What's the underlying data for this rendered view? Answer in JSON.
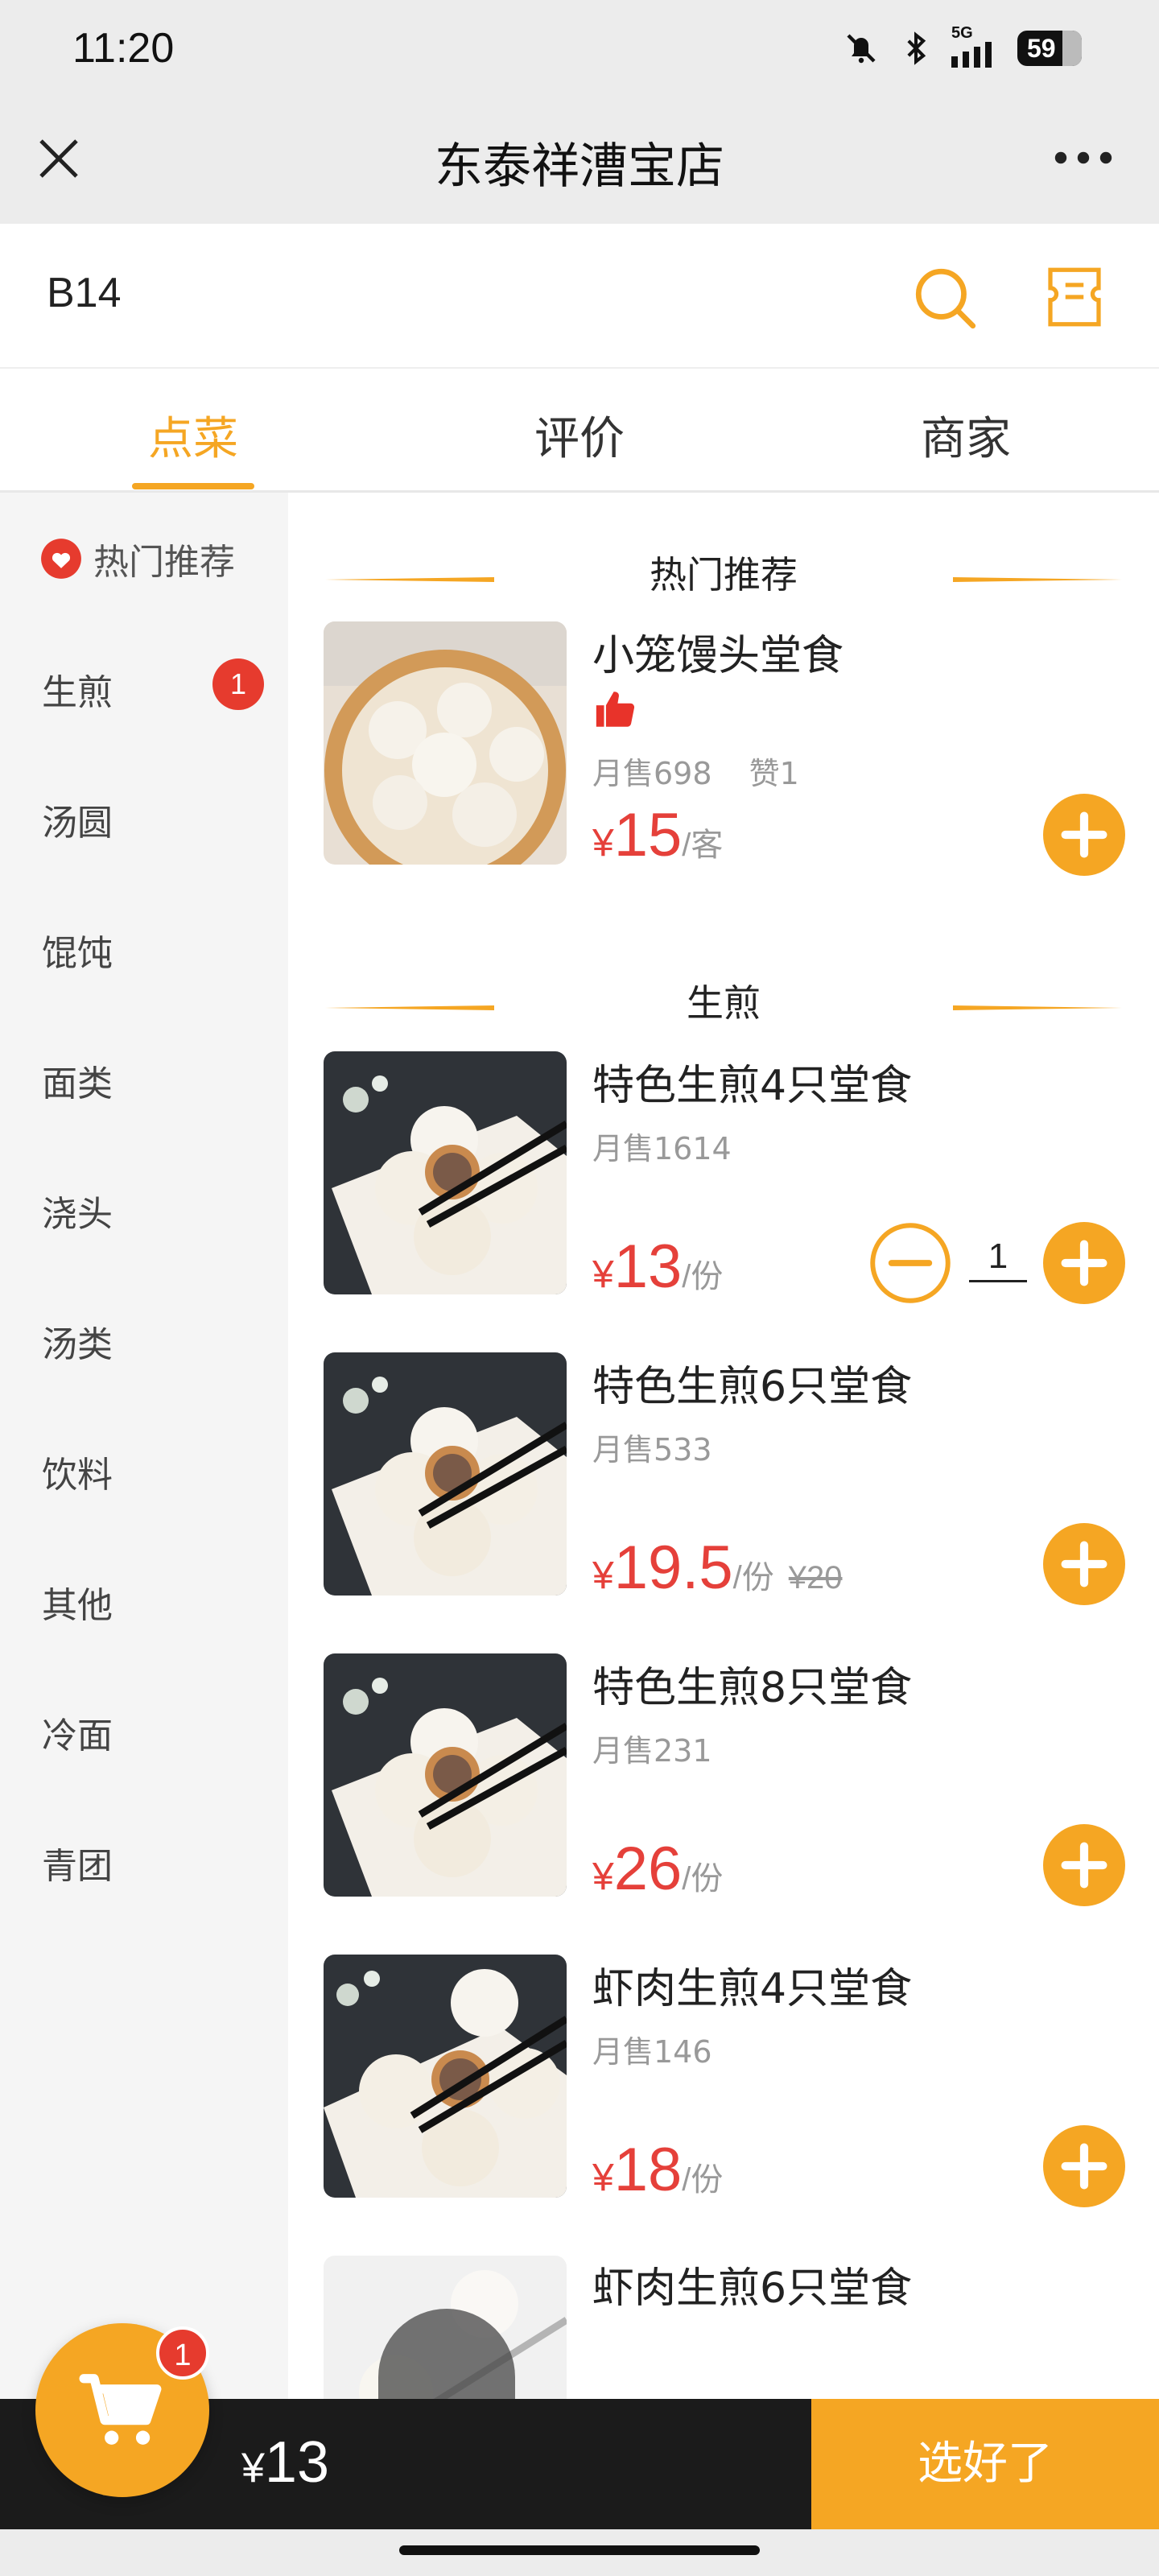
{
  "status_bar": {
    "time": "11:20",
    "network": "5G",
    "battery": "59"
  },
  "nav": {
    "title": "东泰祥漕宝店"
  },
  "search_bar": {
    "table_number": "B14"
  },
  "tabs": [
    {
      "label": "点菜",
      "active": true
    },
    {
      "label": "评价",
      "active": false
    },
    {
      "label": "商家",
      "active": false
    }
  ],
  "sidebar": {
    "items": [
      {
        "label": "热门推荐",
        "icon": "heart-icon"
      },
      {
        "label": "生煎",
        "badge": "1"
      },
      {
        "label": "汤圆"
      },
      {
        "label": "馄饨"
      },
      {
        "label": "面类"
      },
      {
        "label": "浇头"
      },
      {
        "label": "汤类"
      },
      {
        "label": "饮料"
      },
      {
        "label": "其他"
      },
      {
        "label": "冷面"
      },
      {
        "label": "青团"
      }
    ]
  },
  "sections": [
    {
      "title": "热门推荐",
      "items": [
        {
          "name": "小笼馒头堂食",
          "sales": "月售698",
          "likes": "赞1",
          "currency": "¥",
          "price": "15",
          "unit": "/客",
          "icon": "thumbs-up-icon"
        }
      ]
    },
    {
      "title": "生煎",
      "items": [
        {
          "name": "特色生煎4只堂食",
          "sales": "月售1614",
          "currency": "¥",
          "price": "13",
          "unit": "/份",
          "quantity": "1"
        },
        {
          "name": "特色生煎6只堂食",
          "sales": "月售533",
          "currency": "¥",
          "price": "19.5",
          "unit": "/份",
          "original_price": "¥20"
        },
        {
          "name": "特色生煎8只堂食",
          "sales": "月售231",
          "currency": "¥",
          "price": "26",
          "unit": "/份"
        },
        {
          "name": "虾肉生煎4只堂食",
          "sales": "月售146",
          "currency": "¥",
          "price": "18",
          "unit": "/份"
        },
        {
          "name": "虾肉生煎6只堂食"
        }
      ]
    }
  ],
  "cart": {
    "count": "1",
    "currency": "¥",
    "total": "13",
    "confirm_label": "选好了"
  },
  "colors": {
    "accent": "#f5a623",
    "price": "#e5403a",
    "badge": "#e63b2e",
    "bottom_bar": "#1b1b1b"
  }
}
